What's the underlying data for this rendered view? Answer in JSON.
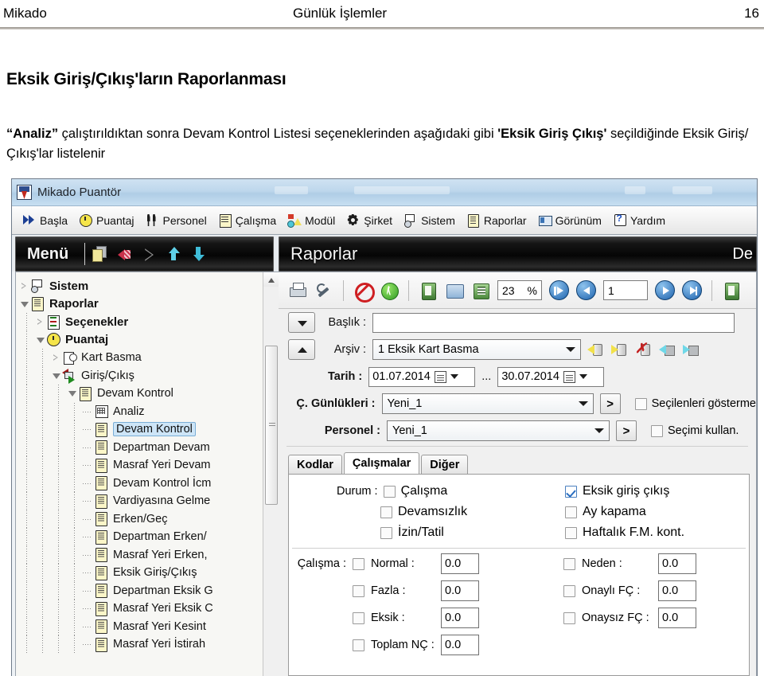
{
  "document": {
    "header": {
      "left": "Mikado",
      "center": "Günlük İşlemler",
      "page": "16"
    },
    "title": "Eksik Giriş/Çıkış'ların Raporlanması",
    "paragraph": {
      "p1": "“Analiz”",
      "p2": " çalıştırıldıktan sonra Devam Kontrol Listesi seçeneklerinden aşağıdaki gibi  ",
      "p3": "'Eksik Giriş Çıkış'",
      "p4": " seçildiğinde Eksik Giriş/Çıkış'lar listelenir"
    }
  },
  "app": {
    "title": "Mikado Puantör",
    "menu": [
      {
        "label": "Başla",
        "icon": "play-icon"
      },
      {
        "label": "Puantaj",
        "icon": "clock-icon"
      },
      {
        "label": "Personel",
        "icon": "people-icon"
      },
      {
        "label": "Çalışma",
        "icon": "list-icon"
      },
      {
        "label": "Modül",
        "icon": "module-icon"
      },
      {
        "label": "Şirket",
        "icon": "gear-icon"
      },
      {
        "label": "Sistem",
        "icon": "system-icon"
      },
      {
        "label": "Raporlar",
        "icon": "reports-icon"
      },
      {
        "label": "Görünüm",
        "icon": "view-icon"
      },
      {
        "label": "Yardım",
        "icon": "help-icon"
      }
    ],
    "menu_bar_title": "Menü",
    "report_bar_title": "Raporlar",
    "report_bar_right": "De"
  },
  "tree": [
    {
      "label": "Sistem",
      "level": 0,
      "state": "closed",
      "icon": "system-icon",
      "bold": true,
      "selected": false
    },
    {
      "label": "Raporlar",
      "level": 0,
      "state": "open",
      "icon": "book-icon",
      "bold": true,
      "selected": false
    },
    {
      "label": "Seçenekler",
      "level": 1,
      "state": "closed",
      "icon": "options-icon",
      "bold": true,
      "selected": false
    },
    {
      "label": "Puantaj",
      "level": 1,
      "state": "open",
      "icon": "clock-icon",
      "bold": true,
      "selected": false
    },
    {
      "label": "Kart Basma",
      "level": 2,
      "state": "closed",
      "icon": "card-icon",
      "bold": false,
      "selected": false
    },
    {
      "label": "Giriş/Çıkış",
      "level": 2,
      "state": "open",
      "icon": "inout-icon",
      "bold": false,
      "selected": false
    },
    {
      "label": "Devam Kontrol",
      "level": 3,
      "state": "open",
      "icon": "book-icon",
      "bold": false,
      "selected": false
    },
    {
      "label": "Analiz",
      "level": 4,
      "state": "leaf",
      "icon": "grid-icon",
      "bold": false,
      "selected": false
    },
    {
      "label": "Devam Kontrol",
      "level": 4,
      "state": "leaf",
      "icon": "book-icon",
      "bold": false,
      "selected": true
    },
    {
      "label": "Departman Devam",
      "level": 4,
      "state": "leaf",
      "icon": "book-icon",
      "bold": false,
      "selected": false
    },
    {
      "label": "Masraf Yeri Devam",
      "level": 4,
      "state": "leaf",
      "icon": "book-icon",
      "bold": false,
      "selected": false
    },
    {
      "label": "Devam Kontrol İcm",
      "level": 4,
      "state": "leaf",
      "icon": "book-icon",
      "bold": false,
      "selected": false
    },
    {
      "label": "Vardiyasına Gelme",
      "level": 4,
      "state": "leaf",
      "icon": "book-icon",
      "bold": false,
      "selected": false
    },
    {
      "label": "Erken/Geç",
      "level": 4,
      "state": "leaf",
      "icon": "book-icon",
      "bold": false,
      "selected": false
    },
    {
      "label": "Departman Erken/",
      "level": 4,
      "state": "leaf",
      "icon": "book-icon",
      "bold": false,
      "selected": false
    },
    {
      "label": "Masraf Yeri Erken,",
      "level": 4,
      "state": "leaf",
      "icon": "book-icon",
      "bold": false,
      "selected": false
    },
    {
      "label": "Eksik Giriş/Çıkış",
      "level": 4,
      "state": "leaf",
      "icon": "book-icon",
      "bold": false,
      "selected": false
    },
    {
      "label": "Departman Eksik G",
      "level": 4,
      "state": "leaf",
      "icon": "book-icon",
      "bold": false,
      "selected": false
    },
    {
      "label": "Masraf Yeri Eksik C",
      "level": 4,
      "state": "leaf",
      "icon": "book-icon",
      "bold": false,
      "selected": false
    },
    {
      "label": "Masraf Yeri Kesint",
      "level": 4,
      "state": "leaf",
      "icon": "book-icon",
      "bold": false,
      "selected": false
    },
    {
      "label": "Masraf Yeri İstirah",
      "level": 4,
      "state": "leaf",
      "icon": "book-icon",
      "bold": false,
      "selected": false
    }
  ],
  "report_toolbar": {
    "zoom_value": "23",
    "zoom_unit": "%",
    "page_value": "1",
    "icons": [
      "print-icon",
      "wrench-icon",
      "stop-icon",
      "run-icon",
      "export-doc-icon",
      "export-data-icon",
      "preview-icon",
      "first-page-icon",
      "prev-page-icon",
      "next-page-icon",
      "last-page-icon",
      "report-icon"
    ]
  },
  "form": {
    "baslik_label": "Başlık :",
    "baslik_value": "",
    "arsiv_label": "Arşiv :",
    "arsiv_value": "1 Eksik Kart Basma",
    "tarih_label": "Tarih :",
    "tarih_start": "01.07.2014",
    "tarih_sep": "...",
    "tarih_end": "30.07.2014",
    "gunlukleri_label": "Ç. Günlükleri :",
    "gunlukleri_value": "Yeni_1",
    "personel_label": "Personel :",
    "personel_value": "Yeni_1",
    "expand_button": ">",
    "checkbox_secilenleri": {
      "label": "Seçilenleri gösterme",
      "checked": false
    },
    "checkbox_secimi": {
      "label": "Seçimi kullan.",
      "checked": false
    },
    "archive_icons": [
      "archive-open-icon",
      "archive-new-icon",
      "archive-delete-icon",
      "archive-load-icon",
      "archive-save-icon"
    ]
  },
  "tabs": [
    {
      "label": "Kodlar",
      "active": false
    },
    {
      "label": "Çalışmalar",
      "active": true
    },
    {
      "label": "Diğer",
      "active": false
    }
  ],
  "durum": {
    "label": "Durum :",
    "left": [
      {
        "label": "Çalışma",
        "checked": false
      },
      {
        "label": "Devamsızlık",
        "checked": false
      },
      {
        "label": "İzin/Tatil",
        "checked": false
      }
    ],
    "right": [
      {
        "label": "Eksik giriş çıkış",
        "checked": true
      },
      {
        "label": "Ay kapama",
        "checked": false
      },
      {
        "label": "Haftalık F.M. kont.",
        "checked": false
      }
    ]
  },
  "calisma": {
    "label": "Çalışma :",
    "left": [
      {
        "label": "Normal :",
        "checked": false,
        "value": "0.0"
      },
      {
        "label": "Fazla :",
        "checked": false,
        "value": "0.0"
      },
      {
        "label": "Eksik :",
        "checked": false,
        "value": "0.0"
      },
      {
        "label": "Toplam NÇ :",
        "checked": false,
        "value": "0.0"
      }
    ],
    "right": [
      {
        "label": "Neden :",
        "checked": false,
        "value": "0.0"
      },
      {
        "label": "Onaylı FÇ :",
        "checked": false,
        "value": "0.0"
      },
      {
        "label": "Onaysız FÇ :",
        "checked": false,
        "value": "0.0"
      }
    ]
  },
  "colors": {
    "title_bar": "#bed7ec",
    "accent_blue": "#1d62ad",
    "selection": "#cde5f7",
    "check": "#2a6ec0"
  }
}
